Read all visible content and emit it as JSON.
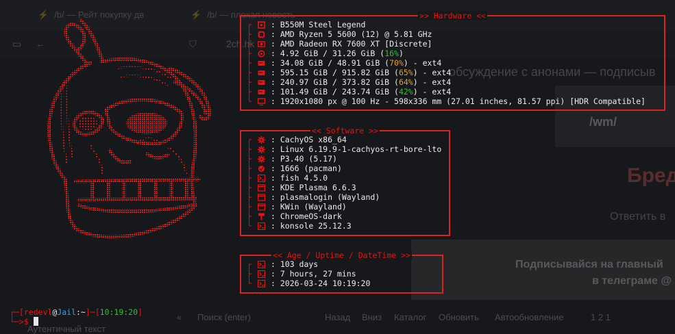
{
  "background_browser": {
    "tabs": [
      "/b/ — Рейт покупку дв",
      "/b/ — плохая новость"
    ],
    "url": "2ch.hk",
    "headline": "обсуждение с анонами — подписыв",
    "board_badge": "/wm/",
    "thread_title": "Бред",
    "reply_label": "Ответить в",
    "banner_line1": "Подписывайся на главный",
    "banner_line2": "в телеграме @",
    "bottom_bar": {
      "search_placeholder": "Поиск (enter)",
      "back": "Назад",
      "top": "Вниз",
      "catalog": "Каталог",
      "refresh": "Обновить",
      "autorefresh": "Автообновление",
      "counts": "1 2 1"
    },
    "footer": "Аутентичный текст"
  },
  "hardware": {
    "title": ">> Hardware <<",
    "rows": [
      {
        "icon": "motherboard-icon",
        "text": "B550M Steel Legend"
      },
      {
        "icon": "cpu-icon",
        "text": "AMD Ryzen 5 5600 (12) @ 5.81 GHz"
      },
      {
        "icon": "gpu-icon",
        "text": "AMD Radeon RX 7600 XT [Discrete]"
      },
      {
        "icon": "memory-icon",
        "text_before": "4.92 GiB / 31.26 GiB (",
        "pct": "16%",
        "pct_color": "green",
        "text_after": ")"
      },
      {
        "icon": "disk-icon",
        "text_before": "34.08 GiB / 48.91 GiB (",
        "pct": "70%",
        "pct_color": "orange",
        "text_after": ") - ext4"
      },
      {
        "icon": "disk-icon",
        "text_before": "595.15 GiB / 915.82 GiB (",
        "pct": "65%",
        "pct_color": "orange",
        "text_after": ") - ext4"
      },
      {
        "icon": "disk-icon",
        "text_before": "240.97 GiB / 373.82 GiB (",
        "pct": "64%",
        "pct_color": "orange",
        "text_after": ") - ext4"
      },
      {
        "icon": "disk-icon",
        "text_before": "101.49 GiB / 243.74 GiB (",
        "pct": "42%",
        "pct_color": "green",
        "text_after": ") - ext4"
      },
      {
        "icon": "monitor-icon",
        "text": "1920x1080 px @ 100 Hz - 598x336 mm (27.01 inches, 81.57 ppi) [HDR Compatible]"
      }
    ]
  },
  "software": {
    "title": "<< Software >>",
    "rows": [
      {
        "icon": "gear-icon",
        "text": "CachyOS x86_64"
      },
      {
        "icon": "gear-icon",
        "text": "Linux 6.19.9-1-cachyos-rt-bore-lto"
      },
      {
        "icon": "gear-icon",
        "text": "P3.40 (5.17)"
      },
      {
        "icon": "package-icon",
        "text": "1666 (pacman)"
      },
      {
        "icon": "terminal-icon",
        "text": "fish 4.5.0"
      },
      {
        "icon": "window-icon",
        "text": "KDE Plasma 6.6.3"
      },
      {
        "icon": "window-icon",
        "text": "plasmalogin (Wayland)"
      },
      {
        "icon": "window-icon",
        "text": "KWin (Wayland)"
      },
      {
        "icon": "brush-icon",
        "text": "ChromeOS-dark"
      },
      {
        "icon": "terminal-icon",
        "text": "konsole 25.12.3"
      }
    ]
  },
  "uptime": {
    "title": "<< Age / Uptime / DateTime >>",
    "rows": [
      {
        "icon": "terminal-icon",
        "text": ": 103 days"
      },
      {
        "icon": "terminal-icon",
        "text": ": 7 hours, 27 mins"
      },
      {
        "icon": "terminal-icon",
        "text": ": 2026-03-24 10:19:20"
      }
    ]
  },
  "prompt": {
    "user": "redevl",
    "host": "Jail",
    "path": "~",
    "time": "10:19:20",
    "symbol": "$"
  },
  "colors": {
    "accent_red": "#e11111",
    "pct_green": "#30c030",
    "pct_orange": "#e0a030",
    "host_blue": "#3aa0e8"
  }
}
